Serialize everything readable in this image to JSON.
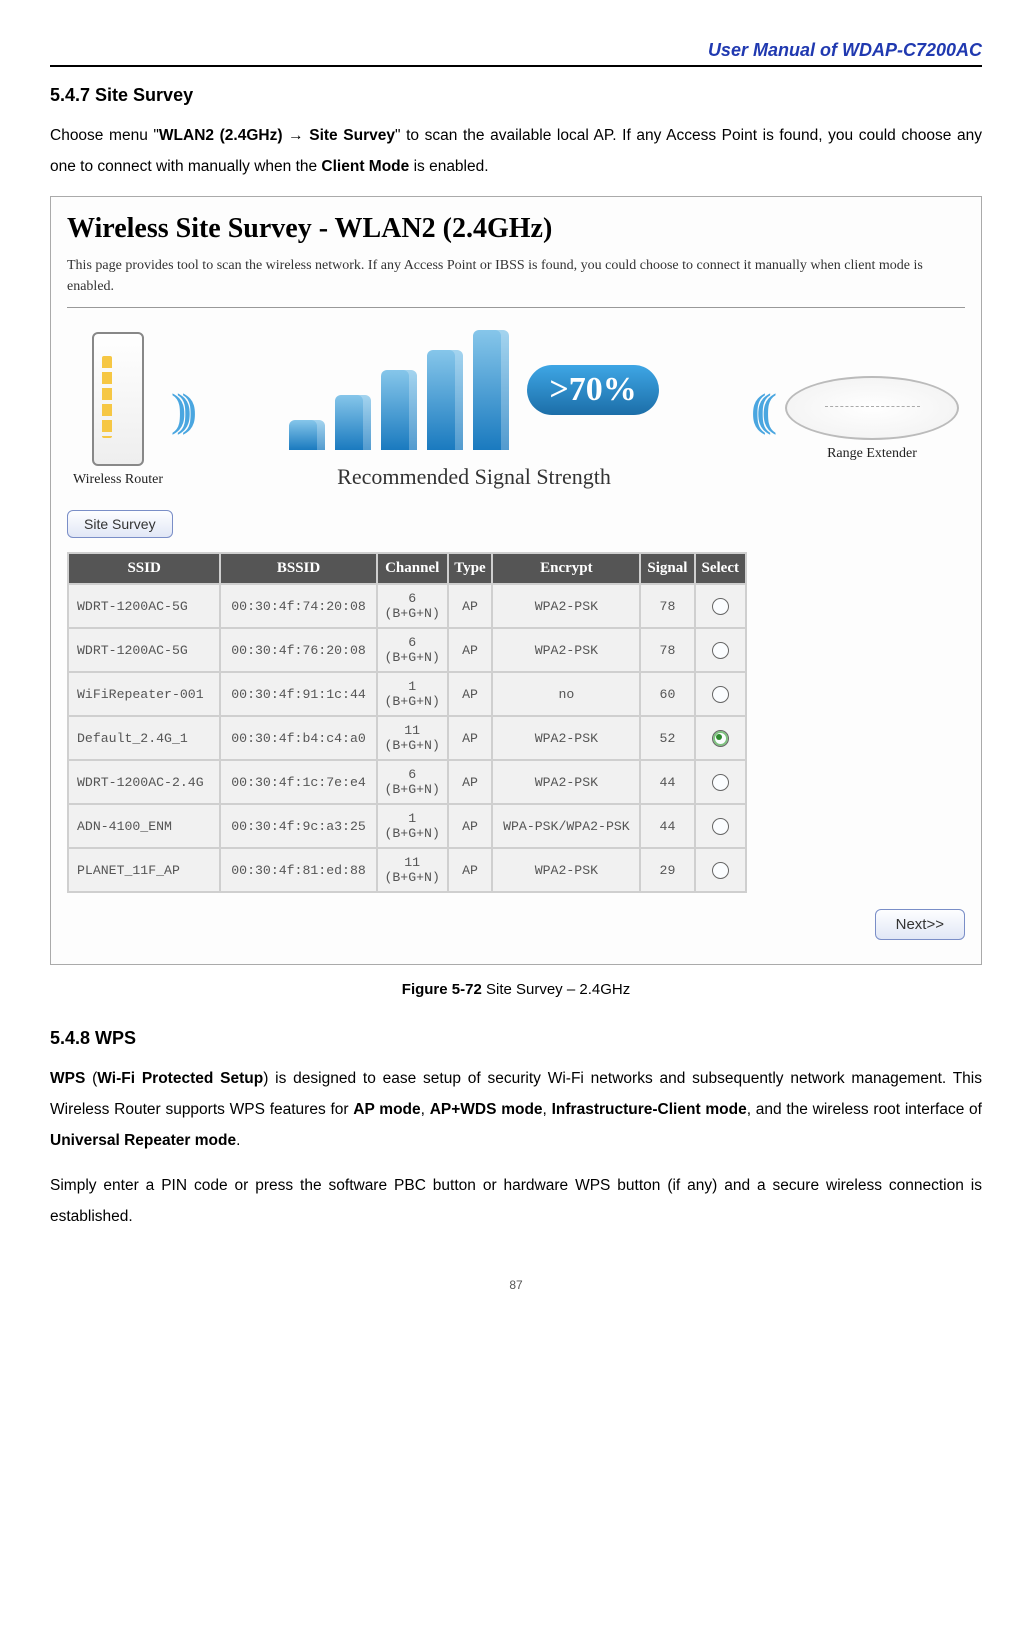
{
  "doc_header": "User Manual of WDAP-C7200AC",
  "section_547": {
    "heading": "5.4.7  Site Survey",
    "para_pre": "Choose menu \"",
    "menu_path": "WLAN2 (2.4GHz) → Site Survey",
    "para_mid": "\" to scan the available local AP. If any Access Point is found, you could choose any one to connect with manually when the ",
    "client_mode": "Client Mode",
    "para_post": " is enabled."
  },
  "panel": {
    "title": "Wireless Site Survey - WLAN2 (2.4GHz)",
    "desc": "This page provides tool to scan the wireless network. If any Access Point or IBSS is found, you could choose to connect it manually when client mode is enabled.",
    "router_label": "Wireless Router",
    "badge": ">70%",
    "strength_caption": "Recommended Signal Strength",
    "extender_label": "Range Extender",
    "survey_button": "Site Survey",
    "next_button": "Next>>"
  },
  "table": {
    "headers": [
      "SSID",
      "BSSID",
      "Channel",
      "Type",
      "Encrypt",
      "Signal",
      "Select"
    ],
    "rows": [
      {
        "ssid": "WDRT-1200AC-5G",
        "bssid": "00:30:4f:74:20:08",
        "channel": "6\n(B+G+N)",
        "type": "AP",
        "encrypt": "WPA2-PSK",
        "signal": "78",
        "selected": false
      },
      {
        "ssid": "WDRT-1200AC-5G",
        "bssid": "00:30:4f:76:20:08",
        "channel": "6\n(B+G+N)",
        "type": "AP",
        "encrypt": "WPA2-PSK",
        "signal": "78",
        "selected": false
      },
      {
        "ssid": "WiFiRepeater-001",
        "bssid": "00:30:4f:91:1c:44",
        "channel": "1\n(B+G+N)",
        "type": "AP",
        "encrypt": "no",
        "signal": "60",
        "selected": false
      },
      {
        "ssid": "Default_2.4G_1",
        "bssid": "00:30:4f:b4:c4:a0",
        "channel": "11\n(B+G+N)",
        "type": "AP",
        "encrypt": "WPA2-PSK",
        "signal": "52",
        "selected": true
      },
      {
        "ssid": "WDRT-1200AC-2.4G",
        "bssid": "00:30:4f:1c:7e:e4",
        "channel": "6\n(B+G+N)",
        "type": "AP",
        "encrypt": "WPA2-PSK",
        "signal": "44",
        "selected": false
      },
      {
        "ssid": "ADN-4100_ENM",
        "bssid": "00:30:4f:9c:a3:25",
        "channel": "1\n(B+G+N)",
        "type": "AP",
        "encrypt": "WPA-PSK/WPA2-PSK",
        "signal": "44",
        "selected": false
      },
      {
        "ssid": "PLANET_11F_AP",
        "bssid": "00:30:4f:81:ed:88",
        "channel": "11\n(B+G+N)",
        "type": "AP",
        "encrypt": "WPA2-PSK",
        "signal": "29",
        "selected": false
      }
    ]
  },
  "figure_caption": {
    "label": "Figure 5-72",
    "text": " Site Survey – 2.4GHz"
  },
  "section_548": {
    "heading": "5.4.8  WPS",
    "wps_abbr": "WPS",
    "wps_full": "Wi-Fi Protected Setup",
    "p1_a": " (",
    "p1_b": ") is designed to ease setup of security Wi-Fi networks and subsequently network management. This Wireless Router supports WPS features for ",
    "m1": "AP mode",
    "c1": ", ",
    "m2": "AP+WDS mode",
    "c2": ", ",
    "m3": "Infrastructure-Client mode",
    "c3": ", and the wireless root interface of ",
    "m4": "Universal Repeater mode",
    "c4": ".",
    "p2": "Simply enter a PIN code or press the software PBC button or hardware WPS button (if any) and a secure wireless connection is established."
  },
  "page_number": "87"
}
